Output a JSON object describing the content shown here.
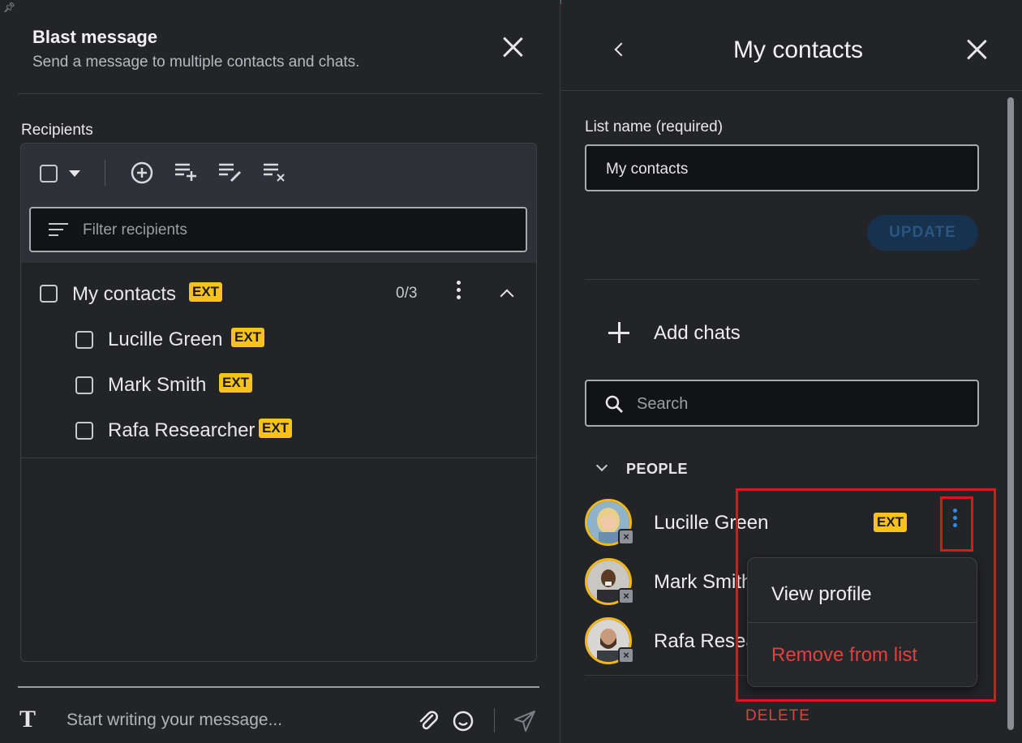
{
  "blast": {
    "title": "Blast message",
    "subtitle": "Send a message to multiple contacts and chats.",
    "recipients_label": "Recipients",
    "filter_placeholder": "Filter recipients",
    "group": {
      "name": "My contacts",
      "badge": "EXT",
      "count": "0/3"
    },
    "members": [
      {
        "name": "Lucille Green",
        "badge": "EXT"
      },
      {
        "name": "Mark Smith",
        "badge": "EXT"
      },
      {
        "name": "Rafa Researcher",
        "badge": "EXT"
      }
    ],
    "compose_icon": "T",
    "compose_placeholder": "Start writing your message..."
  },
  "contacts_panel": {
    "title": "My contacts",
    "list_name_label": "List name (required)",
    "list_name_value": "My contacts",
    "update_label": "UPDATE",
    "add_chats_label": "Add chats",
    "search_placeholder": "Search",
    "people_header": "PEOPLE",
    "people": [
      {
        "name": "Lucille Green",
        "badge": "EXT"
      },
      {
        "name": "Mark Smith",
        "badge": ""
      },
      {
        "name": "Rafa Researcher",
        "badge": ""
      }
    ],
    "delete_label": "DELETE"
  },
  "context_menu": {
    "items": [
      {
        "label": "View profile",
        "color": "#f0f0f2"
      },
      {
        "label": "Remove from list",
        "color": "#e0413d"
      }
    ]
  },
  "colors": {
    "background": "#232428",
    "ext_badge": "#f7c21c",
    "accent_blue": "#1e7fe0",
    "danger": "#e0413d",
    "highlight_annotation": "#e0151c"
  }
}
